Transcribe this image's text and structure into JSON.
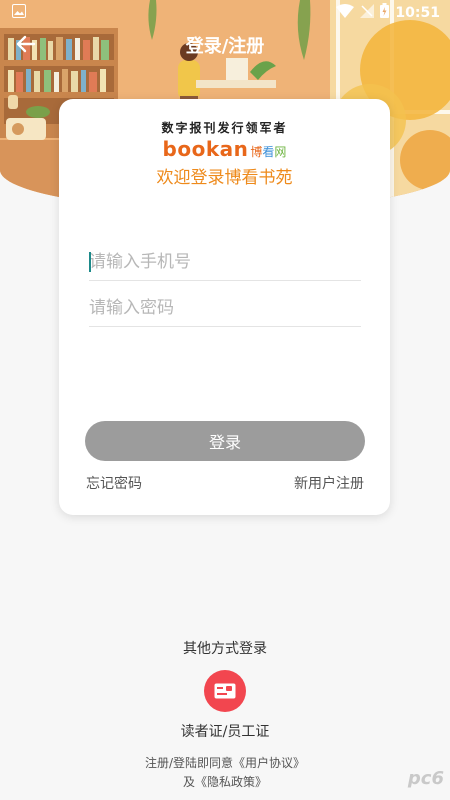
{
  "status_bar": {
    "time": "10:51",
    "icons": [
      "image-icon",
      "wifi-icon",
      "signal-icon",
      "battery-charging-icon"
    ]
  },
  "app_bar": {
    "title": "登录/注册",
    "back_icon": "arrow-left-icon"
  },
  "logo": {
    "slogan": "数字报刊发行领军者",
    "brand_word": "bookan",
    "brand_cn_1": "博",
    "brand_cn_2": "看",
    "brand_cn_3": "网"
  },
  "welcome": "欢迎登录博看书苑",
  "form": {
    "phone_placeholder": "请输入手机号",
    "phone_value": "",
    "password_placeholder": "请输入密码",
    "password_value": "",
    "login_label": "登录",
    "forgot_label": "忘记密码",
    "register_label": "新用户注册"
  },
  "other_login": {
    "title": "其他方式登录",
    "card_icon": "id-card-icon",
    "card_label": "读者证/员工证"
  },
  "agreement": {
    "line1_prefix": "注册/登陆即同意",
    "user_agreement": "《用户协议》",
    "line2_prefix": "及",
    "privacy_policy": "《隐私政策》"
  },
  "watermark": "pc6",
  "colors": {
    "accent_orange": "#ee8a1b",
    "brand_orange": "#e8671a",
    "login_button": "#9c9c9c",
    "card_login_red": "#f2464f",
    "caret_teal": "#1d8a8a"
  }
}
